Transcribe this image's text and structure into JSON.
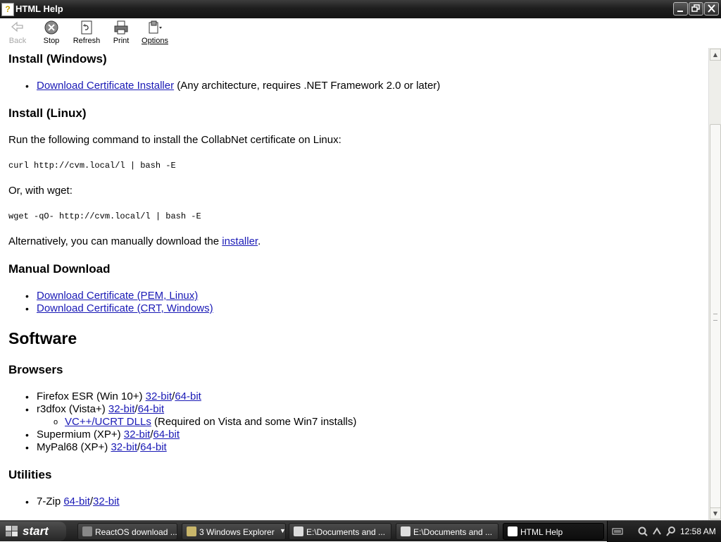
{
  "window": {
    "title": "HTML Help"
  },
  "toolbar": {
    "back": "Back",
    "stop": "Stop",
    "refresh": "Refresh",
    "print": "Print",
    "options": "Options"
  },
  "doc": {
    "install_windows": {
      "heading": "Install (Windows)",
      "link": "Download Certificate Installer",
      "note": " (Any architecture, requires .NET Framework 2.0 or later)"
    },
    "install_linux": {
      "heading": "Install (Linux)",
      "intro": "Run the following command to install the CollabNet certificate on Linux:",
      "cmd_curl": "curl http://cvm.local/l | bash -E",
      "or_wget": "Or, with wget:",
      "cmd_wget": "wget -qO- http://cvm.local/l | bash -E",
      "alt_prefix": "Alternatively, you can manually download the ",
      "alt_link": "installer",
      "alt_suffix": "."
    },
    "manual": {
      "heading": "Manual Download",
      "links": [
        "Download Certificate (PEM, Linux)",
        "Download Certificate (CRT, Windows)"
      ]
    },
    "software": {
      "heading": "Software",
      "browsers": {
        "heading": "Browsers",
        "firefox": {
          "label": "Firefox ESR (Win 10+) ",
          "a": "32-bit",
          "sep": "/",
          "b": "64-bit"
        },
        "r3dfox": {
          "label": "r3dfox (Vista+) ",
          "a": "32-bit",
          "sep": "/",
          "b": "64-bit"
        },
        "vcrt": {
          "link": "VC++/UCRT DLLs",
          "note": " (Required on Vista and some Win7 installs)"
        },
        "supermium": {
          "label": "Supermium (XP+) ",
          "a": "32-bit",
          "sep": "/",
          "b": "64-bit"
        },
        "mypal": {
          "label": "MyPal68 (XP+) ",
          "a": "32-bit",
          "sep": "/",
          "b": "64-bit"
        }
      },
      "utilities": {
        "heading": "Utilities",
        "sevenzip": {
          "label": "7-Zip ",
          "a": "64-bit",
          "sep": "/",
          "b": "32-bit"
        }
      }
    }
  },
  "taskbar": {
    "start": "start",
    "tasks": [
      "ReactOS download ...",
      "3 Windows Explorer",
      "E:\\Documents and ...",
      "E:\\Documents and ...",
      "HTML Help"
    ],
    "clock": "12:58 AM"
  }
}
